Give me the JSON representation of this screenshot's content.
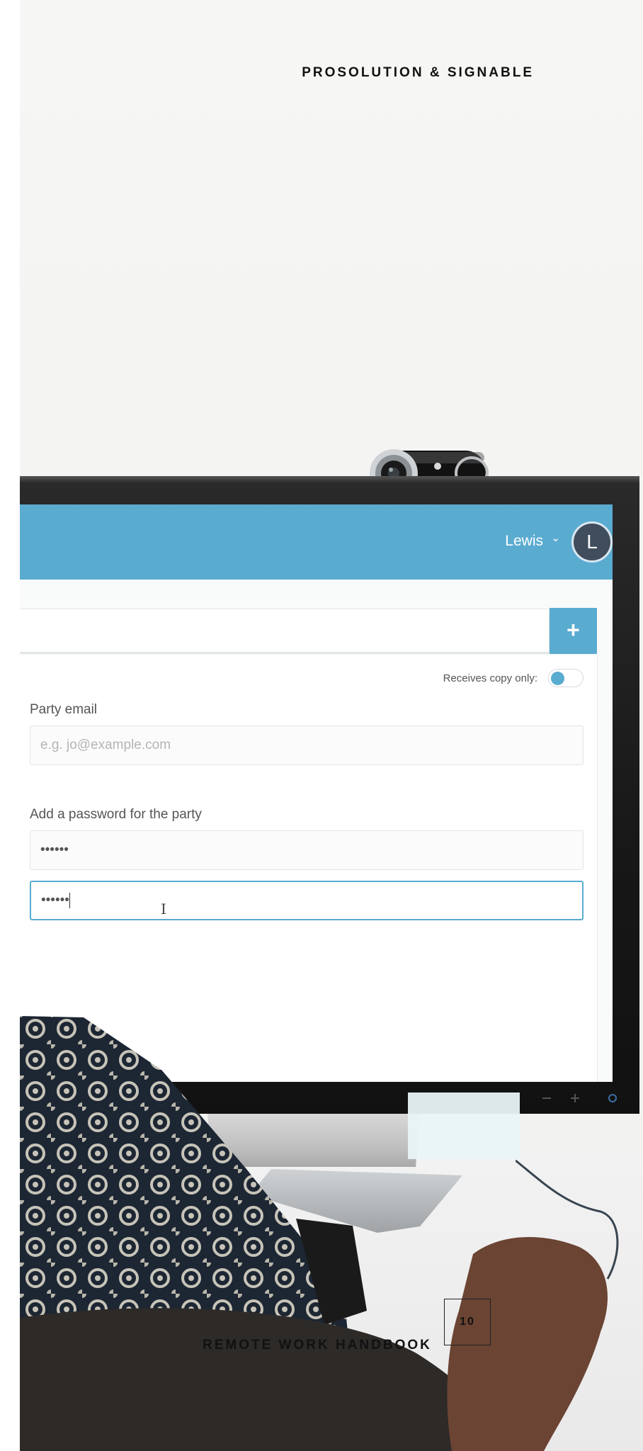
{
  "header": {
    "brand": "PROSOLUTION & SIGNABLE"
  },
  "app": {
    "user": {
      "name": "Lewis",
      "avatar_letter": "L"
    },
    "add_button_label": "+",
    "receives_copy_label": "Receives copy only:",
    "receives_copy_toggle": true,
    "party_email": {
      "label": "Party email",
      "placeholder": "e.g. jo@example.com",
      "value": ""
    },
    "password": {
      "label": "Add a password for the party",
      "value": "••••••",
      "confirm_value": "••••••"
    }
  },
  "footer": {
    "title": "REMOTE WORK HANDBOOK",
    "page_number": "10"
  },
  "colors": {
    "accent": "#5aabd0",
    "avatar_bg": "#3f4d5c"
  }
}
